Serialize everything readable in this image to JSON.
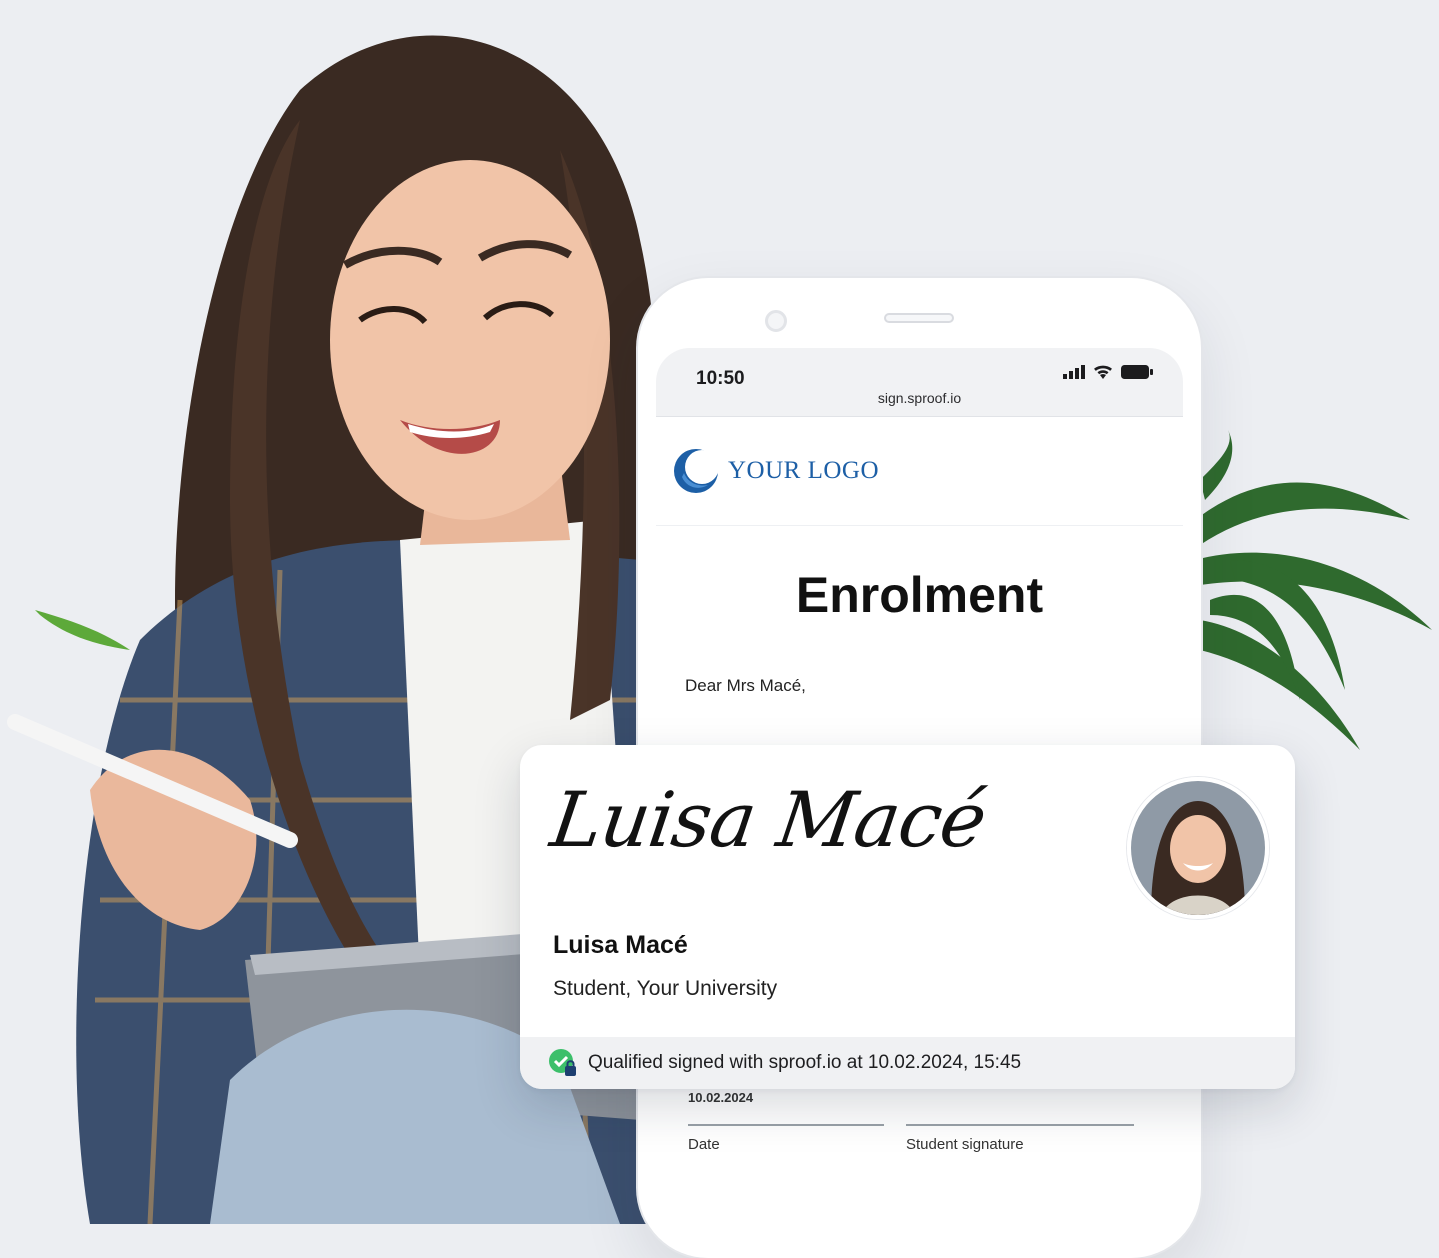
{
  "phone": {
    "status_time": "10:50",
    "url": "sign.sproof.io",
    "icons": [
      "signal-icon",
      "wifi-icon",
      "battery-icon"
    ]
  },
  "document": {
    "logo_text": "YOUR LOGO",
    "title": "Enrolment",
    "greeting": "Dear Mrs Macé,",
    "date_value": "10.02.2024",
    "date_label": "Date",
    "signature_label": "Student signature"
  },
  "signature_card": {
    "script_signature": "Luisa Macé",
    "name": "Luisa Macé",
    "role": "Student, Your University",
    "footer_text": "Qualified signed with sproof.io at 10.02.2024, 15:45",
    "badge_color": "#3cbf6a"
  },
  "colors": {
    "background": "#eceef2",
    "logo_blue": "#1d5fa6",
    "plant_green": "#2f6a2e"
  }
}
